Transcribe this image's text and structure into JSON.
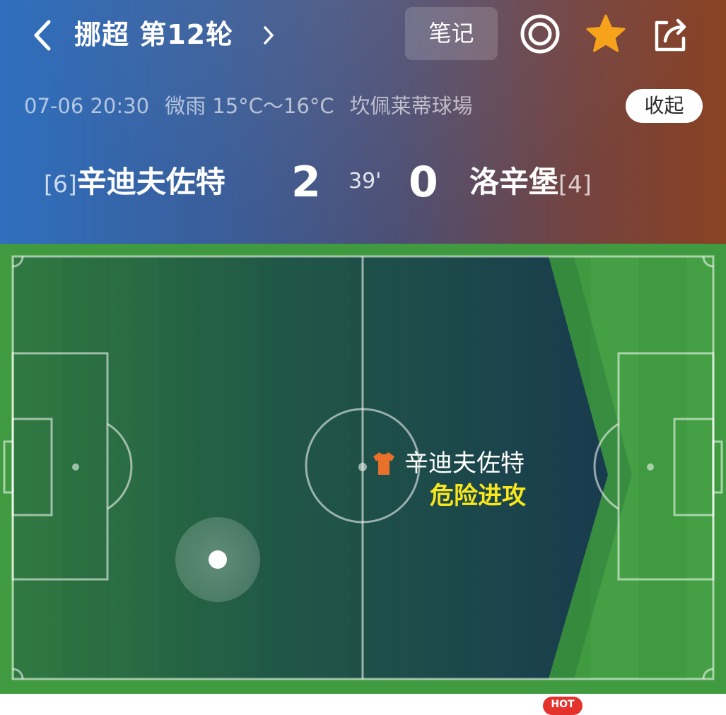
{
  "header": {
    "league_round": "挪超 第12轮",
    "note_label": "笔记",
    "info": {
      "datetime": "07-06 20:30",
      "weather": "微雨 15°C～16°C",
      "venue": "坎佩莱蒂球場"
    },
    "collapse_label": "收起",
    "colors": {
      "gradient_left": "#2f6fbe",
      "gradient_right": "#8a4223"
    }
  },
  "match": {
    "home": {
      "rank": "[6]",
      "name": "辛迪夫佐特",
      "score": "2"
    },
    "away": {
      "rank": "[4]",
      "name": "洛辛堡",
      "score": "0"
    },
    "minute": "39'"
  },
  "live_event": {
    "team": "辛迪夫佐特",
    "event": "危险进攻",
    "event_color": "#f9e61b",
    "team_shirt_color": "#e8702a"
  },
  "icons": [
    "back-icon",
    "chevron-right-icon",
    "live-target-icon",
    "star-icon",
    "share-icon",
    "shirt-icon"
  ],
  "footer": {
    "badge": "HOT"
  }
}
